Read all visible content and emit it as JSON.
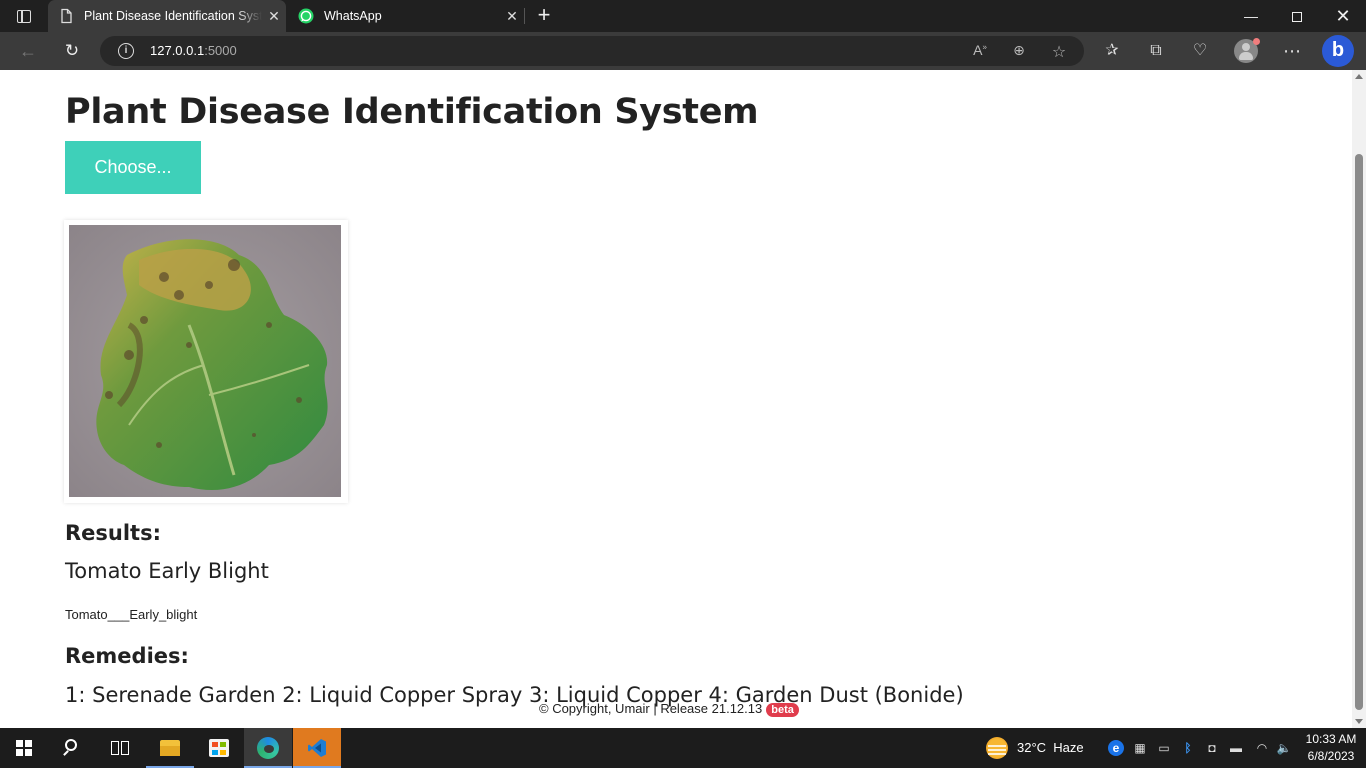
{
  "browser": {
    "tabs": [
      {
        "title": "Plant Disease Identification System",
        "active": true
      },
      {
        "title": "WhatsApp",
        "active": false
      }
    ],
    "url_host": "127.0.0.1",
    "url_port": ":5000"
  },
  "page": {
    "title": "Plant Disease Identification System",
    "choose_label": "Choose...",
    "results_heading": "Results:",
    "result_name": "Tomato Early Blight",
    "result_class": "Tomato___Early_blight",
    "remedies_heading": "Remedies:",
    "remedies_text": "1: Serenade Garden 2: Liquid Copper Spray 3: Liquid Copper 4: Garden Dust (Bonide)",
    "footer_text": "© Copyright, Umair | Release 21.12.13",
    "footer_badge": "beta",
    "accent_color": "#3ed0b9"
  },
  "taskbar": {
    "weather_temp": "32°C",
    "weather_desc": "Haze",
    "time": "10:33 AM",
    "date": "6/8/2023"
  },
  "icons": [
    "tab-actions-icon",
    "page-icon",
    "whatsapp-icon",
    "close-icon",
    "new-tab-icon",
    "minimize-icon",
    "maximize-icon",
    "back-icon",
    "reload-icon",
    "info-icon",
    "read-aloud-icon",
    "zoom-icon",
    "favorite-icon",
    "favorites-icon",
    "collections-icon",
    "performance-icon",
    "profile-icon",
    "more-icon",
    "bing-icon",
    "windows-icon",
    "search-icon",
    "task-view-icon",
    "file-explorer-icon",
    "store-icon",
    "edge-icon",
    "vscode-icon",
    "weather-icon",
    "bluetooth-icon",
    "wifi-icon",
    "volume-icon"
  ]
}
